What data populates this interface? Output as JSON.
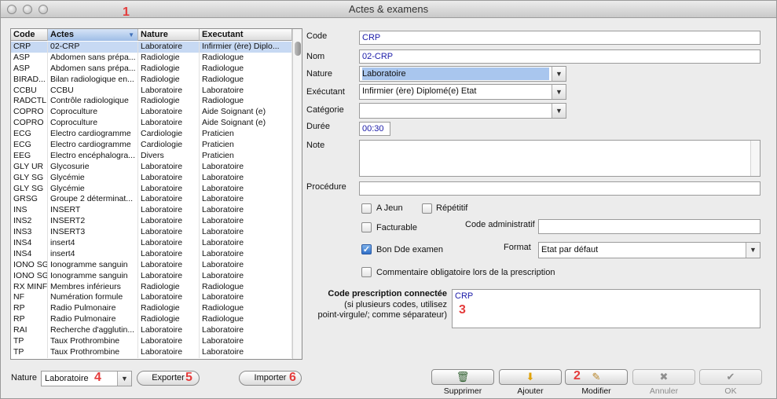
{
  "window": {
    "title": "Actes & examens"
  },
  "annotations": {
    "a1": "1",
    "a2": "2",
    "a3": "3",
    "a4": "4",
    "a5": "5",
    "a6": "6"
  },
  "table": {
    "headers": [
      "Code",
      "Actes",
      "Nature",
      "Executant"
    ],
    "rows": [
      [
        "CRP",
        "02-CRP",
        "Laboratoire",
        "Infirmier (ère) Diplo..."
      ],
      [
        "ASP",
        "Abdomen sans prépa...",
        "Radiologie",
        "Radiologue"
      ],
      [
        "ASP",
        "Abdomen sans prépa...",
        "Radiologie",
        "Radiologue"
      ],
      [
        "BIRAD...",
        "Bilan radiologique en...",
        "Radiologie",
        "Radiologue"
      ],
      [
        "CCBU",
        "CCBU",
        "Laboratoire",
        "Laboratoire"
      ],
      [
        "RADCTL",
        "Contrôle radiologique",
        "Radiologie",
        "Radiologue"
      ],
      [
        "COPRO",
        "Coproculture",
        "Laboratoire",
        "Aide Soignant (e)"
      ],
      [
        "COPRO",
        "Coproculture",
        "Laboratoire",
        "Aide Soignant (e)"
      ],
      [
        "ECG",
        "Electro cardiogramme",
        "Cardiologie",
        "Praticien"
      ],
      [
        "ECG",
        "Electro cardiogramme",
        "Cardiologie",
        "Praticien"
      ],
      [
        "EEG",
        "Electro encéphalogra...",
        "Divers",
        "Praticien"
      ],
      [
        "GLY UR",
        "Glycosurie",
        "Laboratoire",
        "Laboratoire"
      ],
      [
        "GLY SG",
        "Glycémie",
        "Laboratoire",
        "Laboratoire"
      ],
      [
        "GLY SG",
        "Glycémie",
        "Laboratoire",
        "Laboratoire"
      ],
      [
        "GRSG",
        "Groupe 2 déterminat...",
        "Laboratoire",
        "Laboratoire"
      ],
      [
        "INS",
        "INSERT",
        "Laboratoire",
        "Laboratoire"
      ],
      [
        "INS2",
        "INSERT2",
        "Laboratoire",
        "Laboratoire"
      ],
      [
        "INS3",
        "INSERT3",
        "Laboratoire",
        "Laboratoire"
      ],
      [
        "INS4",
        "insert4",
        "Laboratoire",
        "Laboratoire"
      ],
      [
        "INS4",
        "insert4",
        "Laboratoire",
        "Laboratoire"
      ],
      [
        "IONO SG",
        "Ionogramme sanguin",
        "Laboratoire",
        "Laboratoire"
      ],
      [
        "IONO SG",
        "Ionogramme sanguin",
        "Laboratoire",
        "Laboratoire"
      ],
      [
        "RX MINF",
        "Membres inférieurs",
        "Radiologie",
        "Radiologue"
      ],
      [
        "NF",
        "Numération formule",
        "Laboratoire",
        "Laboratoire"
      ],
      [
        "RP",
        "Radio Pulmonaire",
        "Radiologie",
        "Radiologue"
      ],
      [
        "RP",
        "Radio Pulmonaire",
        "Radiologie",
        "Radiologue"
      ],
      [
        "RAI",
        "Recherche d'agglutin...",
        "Laboratoire",
        "Laboratoire"
      ],
      [
        "TP",
        "Taux Prothrombine",
        "Laboratoire",
        "Laboratoire"
      ],
      [
        "TP",
        "Taux Prothrombine",
        "Laboratoire",
        "Laboratoire"
      ]
    ]
  },
  "filter": {
    "nature_label": "Nature",
    "nature_value": "Laboratoire",
    "export_label": "Exporter",
    "import_label": "Importer"
  },
  "form": {
    "code_label": "Code",
    "code_value": "CRP",
    "nom_label": "Nom",
    "nom_value": "02-CRP",
    "nature_label": "Nature",
    "nature_value": "Laboratoire",
    "executant_label": "Exécutant",
    "executant_value": "Infirmier (ère) Diplomé(e) Etat",
    "categorie_label": "Catégorie",
    "categorie_value": "",
    "duree_label": "Durée",
    "duree_value": "00:30",
    "note_label": "Note",
    "procedure_label": "Procédure",
    "ajeun_label": "A Jeun",
    "repetitif_label": "Répétitif",
    "facturable_label": "Facturable",
    "code_admin_label": "Code administratif",
    "bon_label": "Bon Dde examen",
    "format_label": "Format",
    "format_value": "Etat par défaut",
    "commentaire_label": "Commentaire obligatoire lors de la prescription",
    "cpc_label": "Code prescription connectée",
    "cpc_hint1": "(si plusieurs codes, utilisez",
    "cpc_hint2": "point-virgule/; comme séparateur)",
    "cpc_value": "CRP"
  },
  "actions": {
    "supprimer": "Supprimer",
    "ajouter": "Ajouter",
    "modifier": "Modifier",
    "annuler": "Annuler",
    "ok": "OK"
  }
}
